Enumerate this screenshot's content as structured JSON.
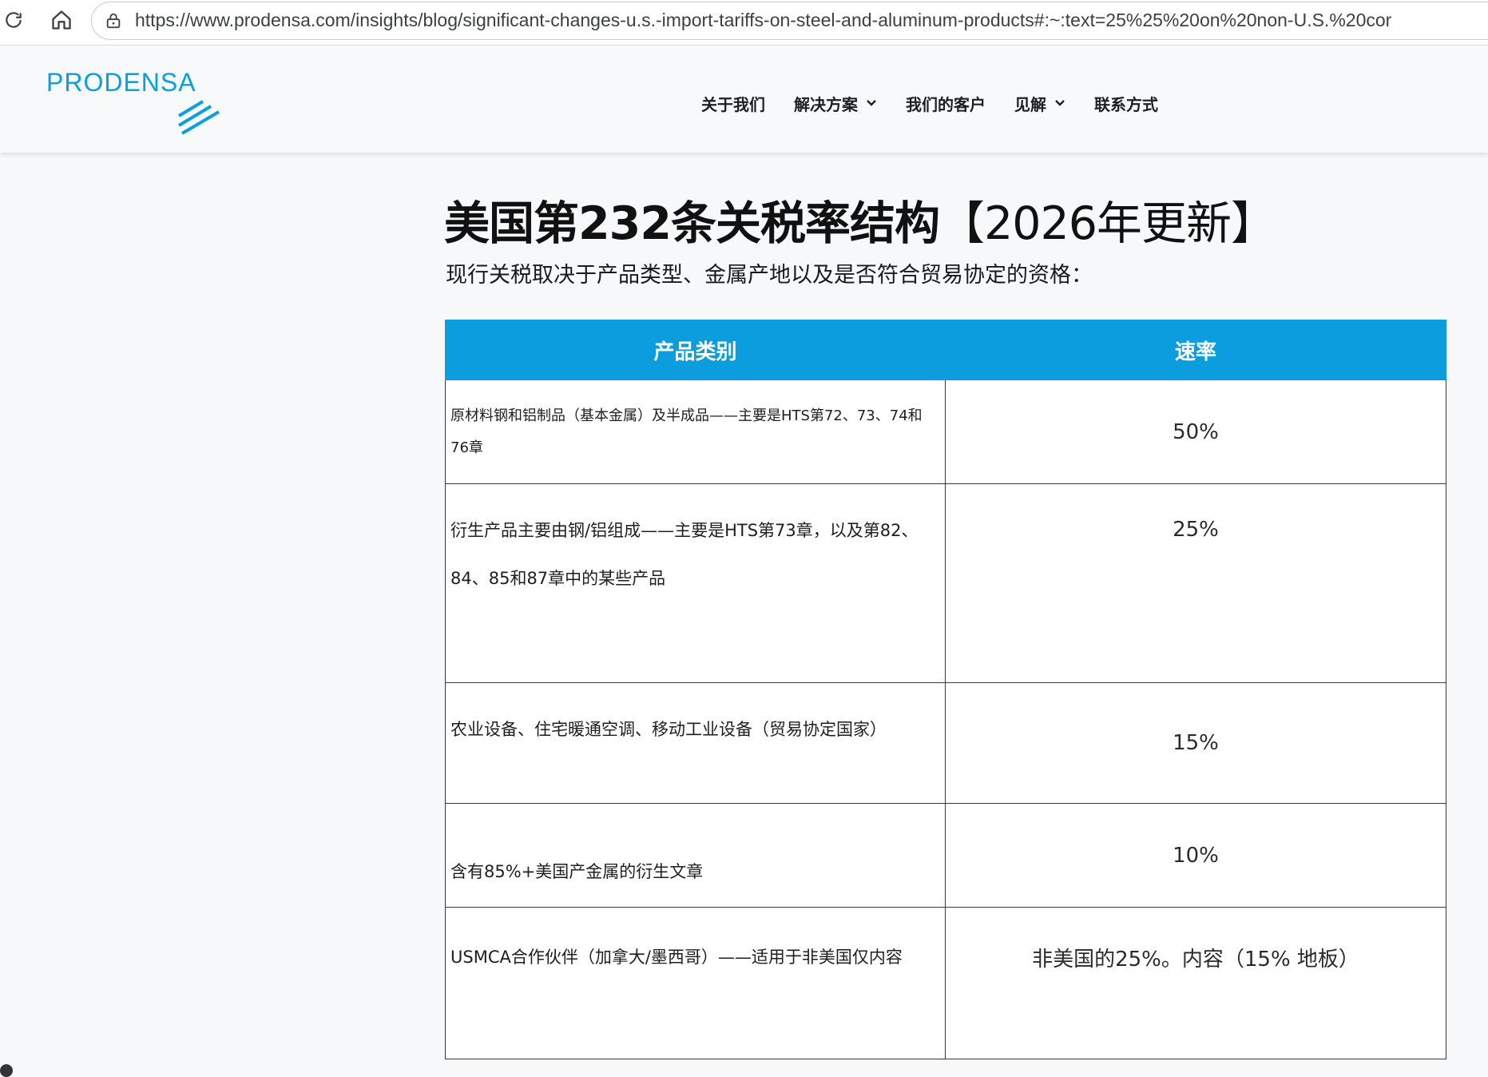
{
  "browser": {
    "url": "https://www.prodensa.com/insights/blog/significant-changes-u.s.-import-tariffs-on-steel-and-aluminum-products#:~:text=25%25%20on%20non-U.S.%20cor",
    "reload_icon": "reload-icon",
    "home_icon": "home-icon",
    "site_info_icon": "site-info-icon"
  },
  "header": {
    "logo_text": "PRODENSA",
    "nav": [
      {
        "label": "关于我们",
        "has_dropdown": false
      },
      {
        "label": "解决方案",
        "has_dropdown": true
      },
      {
        "label": "我们的客户",
        "has_dropdown": false
      },
      {
        "label": "见解",
        "has_dropdown": true
      },
      {
        "label": "联系方式",
        "has_dropdown": false
      }
    ],
    "brand_color": "#0aa0dc"
  },
  "article": {
    "title_bold": "美国第232条关税率结构",
    "title_light": "【2026年更新】",
    "intro": "现行关税取决于产品类型、金属产地以及是否符合贸易协定的资格："
  },
  "table": {
    "header_color": "#0c9ddf",
    "columns": [
      "产品类别",
      "速率"
    ],
    "rows": [
      {
        "category": "原材料钢和铝制品（基本金属）及半成品——主要是HTS第72、73、74和76章",
        "rate": "50%"
      },
      {
        "category": "衍生产品主要由钢/铝组成——主要是HTS第73章，以及第82、84、85和87章中的某些产品",
        "rate": "25%"
      },
      {
        "category": "农业设备、住宅暖通空调、移动工业设备（贸易协定国家）",
        "rate": "15%"
      },
      {
        "category": "含有85%+美国产金属的衍生文章",
        "rate": "10%"
      },
      {
        "category": "USMCA合作伙伴（加拿大/墨西哥）——适用于非美国仅内容",
        "rate": "非美国的25%。内容（15% 地板）"
      }
    ]
  }
}
